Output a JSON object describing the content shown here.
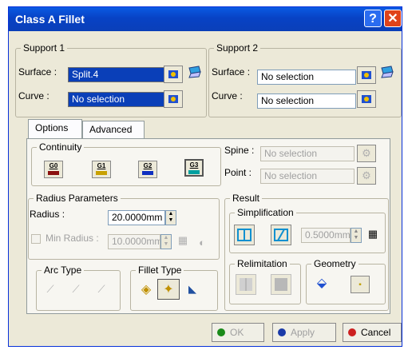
{
  "window": {
    "title": "Class A Fillet"
  },
  "support1": {
    "legend": "Support 1",
    "surface_label": "Surface :",
    "surface_value": "Split.4",
    "curve_label": "Curve :",
    "curve_value": "No selection"
  },
  "support2": {
    "legend": "Support 2",
    "surface_label": "Surface :",
    "surface_value": "No selection",
    "curve_label": "Curve :",
    "curve_value": "No selection"
  },
  "tabs": [
    {
      "label": "Options"
    },
    {
      "label": "Advanced"
    }
  ],
  "continuity": {
    "legend": "Continuity",
    "buttons": [
      {
        "label": "G0",
        "color": "#8b1010"
      },
      {
        "label": "G1",
        "color": "#c8a000"
      },
      {
        "label": "G2",
        "color": "#1030c0"
      },
      {
        "label": "G3",
        "color": "#00a0a0"
      }
    ]
  },
  "spine": {
    "label": "Spine :",
    "value": "No selection"
  },
  "point": {
    "label": "Point :",
    "value": "No selection"
  },
  "radius_params": {
    "legend": "Radius Parameters",
    "radius_label": "Radius :",
    "radius_value": "20.0000mm",
    "min_radius_label": "Min Radius :",
    "min_radius_value": "10.0000mm"
  },
  "arc_type": {
    "legend": "Arc Type"
  },
  "fillet_type": {
    "legend": "Fillet Type"
  },
  "result": {
    "legend": "Result",
    "simplification_legend": "Simplification",
    "simplification_value": "0.5000mm",
    "relimitation_legend": "Relimitation",
    "geometry_legend": "Geometry"
  },
  "buttons": {
    "ok": "OK",
    "apply": "Apply",
    "cancel": "Cancel"
  }
}
